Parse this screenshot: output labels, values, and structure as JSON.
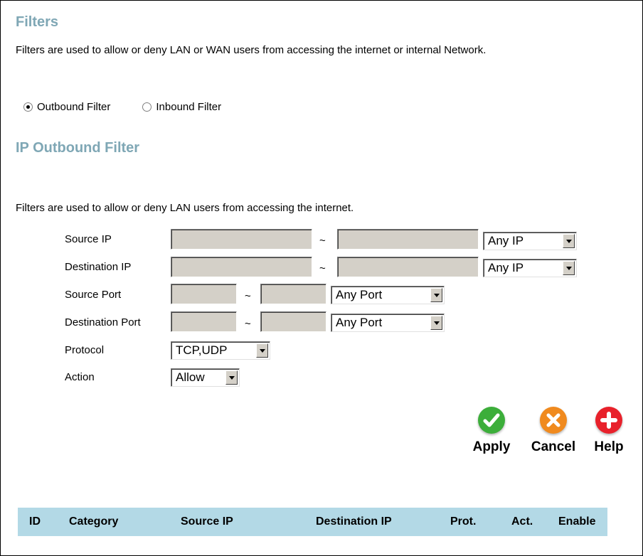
{
  "title": "Filters",
  "description": "Filters are used to allow or deny LAN or WAN users from accessing the internet or internal Network.",
  "filter_type": {
    "options": [
      {
        "label": "Outbound Filter",
        "checked": true
      },
      {
        "label": "Inbound Filter",
        "checked": false
      }
    ]
  },
  "section_title": "IP Outbound Filter",
  "section_description": "Filters are used to allow or deny LAN users from accessing the internet.",
  "form": {
    "source_ip": {
      "label": "Source IP",
      "start": "",
      "end": "",
      "mode": "Any IP"
    },
    "destination_ip": {
      "label": "Destination IP",
      "start": "",
      "end": "",
      "mode": "Any IP"
    },
    "source_port": {
      "label": "Source Port",
      "start": "",
      "end": "",
      "mode": "Any Port"
    },
    "destination_port": {
      "label": "Destination Port",
      "start": "",
      "end": "",
      "mode": "Any Port"
    },
    "protocol": {
      "label": "Protocol",
      "value": "TCP,UDP"
    },
    "action": {
      "label": "Action",
      "value": "Allow"
    },
    "range_separator": "~"
  },
  "buttons": {
    "apply": "Apply",
    "cancel": "Cancel",
    "help": "Help"
  },
  "colors": {
    "heading": "#7fa7b5",
    "table_header_bg": "#b3d9e6",
    "apply": "#3cae3a",
    "cancel": "#f08a1e",
    "help": "#e8212b"
  },
  "icons": {
    "apply": "check-circle-icon",
    "cancel": "x-circle-icon",
    "help": "plus-circle-icon"
  },
  "table": {
    "columns": [
      "ID",
      "Category",
      "Source IP",
      "Destination IP",
      "Prot.",
      "Act.",
      "Enable"
    ]
  }
}
